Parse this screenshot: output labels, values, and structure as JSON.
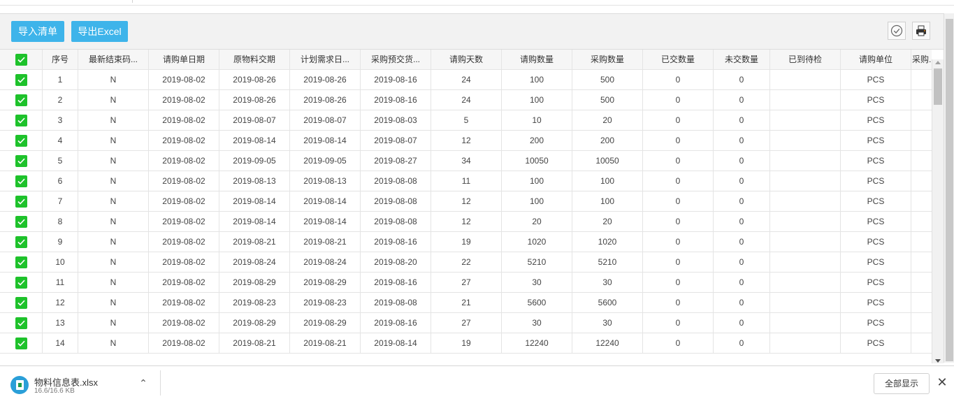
{
  "toolbar": {
    "import_label": "导入清单",
    "export_label": "导出Excel",
    "accent_color": "#3eb4ea"
  },
  "icons": {
    "check_circle": "check-circle-icon",
    "print": "printer-icon",
    "checkbox": "checkbox-checked-icon",
    "checkbox_color": "#1ec22b"
  },
  "table": {
    "columns": [
      "序号",
      "最新结束码...",
      "请购单日期",
      "原物料交期",
      "计划需求日...",
      "采购预交货...",
      "请购天数",
      "请购数量",
      "采购数量",
      "已交数量",
      "未交数量",
      "已到待检",
      "请购单位",
      "采购..."
    ],
    "rows": [
      [
        "1",
        "N",
        "2019-08-02",
        "2019-08-26",
        "2019-08-26",
        "2019-08-16",
        "24",
        "100",
        "500",
        "0",
        "0",
        "",
        "PCS",
        ""
      ],
      [
        "2",
        "N",
        "2019-08-02",
        "2019-08-26",
        "2019-08-26",
        "2019-08-16",
        "24",
        "100",
        "500",
        "0",
        "0",
        "",
        "PCS",
        ""
      ],
      [
        "3",
        "N",
        "2019-08-02",
        "2019-08-07",
        "2019-08-07",
        "2019-08-03",
        "5",
        "10",
        "20",
        "0",
        "0",
        "",
        "PCS",
        ""
      ],
      [
        "4",
        "N",
        "2019-08-02",
        "2019-08-14",
        "2019-08-14",
        "2019-08-07",
        "12",
        "200",
        "200",
        "0",
        "0",
        "",
        "PCS",
        ""
      ],
      [
        "5",
        "N",
        "2019-08-02",
        "2019-09-05",
        "2019-09-05",
        "2019-08-27",
        "34",
        "10050",
        "10050",
        "0",
        "0",
        "",
        "PCS",
        ""
      ],
      [
        "6",
        "N",
        "2019-08-02",
        "2019-08-13",
        "2019-08-13",
        "2019-08-08",
        "11",
        "100",
        "100",
        "0",
        "0",
        "",
        "PCS",
        ""
      ],
      [
        "7",
        "N",
        "2019-08-02",
        "2019-08-14",
        "2019-08-14",
        "2019-08-08",
        "12",
        "100",
        "100",
        "0",
        "0",
        "",
        "PCS",
        ""
      ],
      [
        "8",
        "N",
        "2019-08-02",
        "2019-08-14",
        "2019-08-14",
        "2019-08-08",
        "12",
        "20",
        "20",
        "0",
        "0",
        "",
        "PCS",
        ""
      ],
      [
        "9",
        "N",
        "2019-08-02",
        "2019-08-21",
        "2019-08-21",
        "2019-08-16",
        "19",
        "1020",
        "1020",
        "0",
        "0",
        "",
        "PCS",
        ""
      ],
      [
        "10",
        "N",
        "2019-08-02",
        "2019-08-24",
        "2019-08-24",
        "2019-08-20",
        "22",
        "5210",
        "5210",
        "0",
        "0",
        "",
        "PCS",
        ""
      ],
      [
        "11",
        "N",
        "2019-08-02",
        "2019-08-29",
        "2019-08-29",
        "2019-08-16",
        "27",
        "30",
        "30",
        "0",
        "0",
        "",
        "PCS",
        ""
      ],
      [
        "12",
        "N",
        "2019-08-02",
        "2019-08-23",
        "2019-08-23",
        "2019-08-08",
        "21",
        "5600",
        "5600",
        "0",
        "0",
        "",
        "PCS",
        ""
      ],
      [
        "13",
        "N",
        "2019-08-02",
        "2019-08-29",
        "2019-08-29",
        "2019-08-16",
        "27",
        "30",
        "30",
        "0",
        "0",
        "",
        "PCS",
        ""
      ],
      [
        "14",
        "N",
        "2019-08-02",
        "2019-08-21",
        "2019-08-21",
        "2019-08-14",
        "19",
        "12240",
        "12240",
        "0",
        "0",
        "",
        "PCS",
        ""
      ]
    ]
  },
  "download": {
    "file_name": "物料信息表.xlsx",
    "file_size": "16.6/16.6 KB",
    "file_icon": "excel-file-icon",
    "show_all_label": "全部显示",
    "close_label": "✕",
    "chevron_label": "⌃"
  }
}
